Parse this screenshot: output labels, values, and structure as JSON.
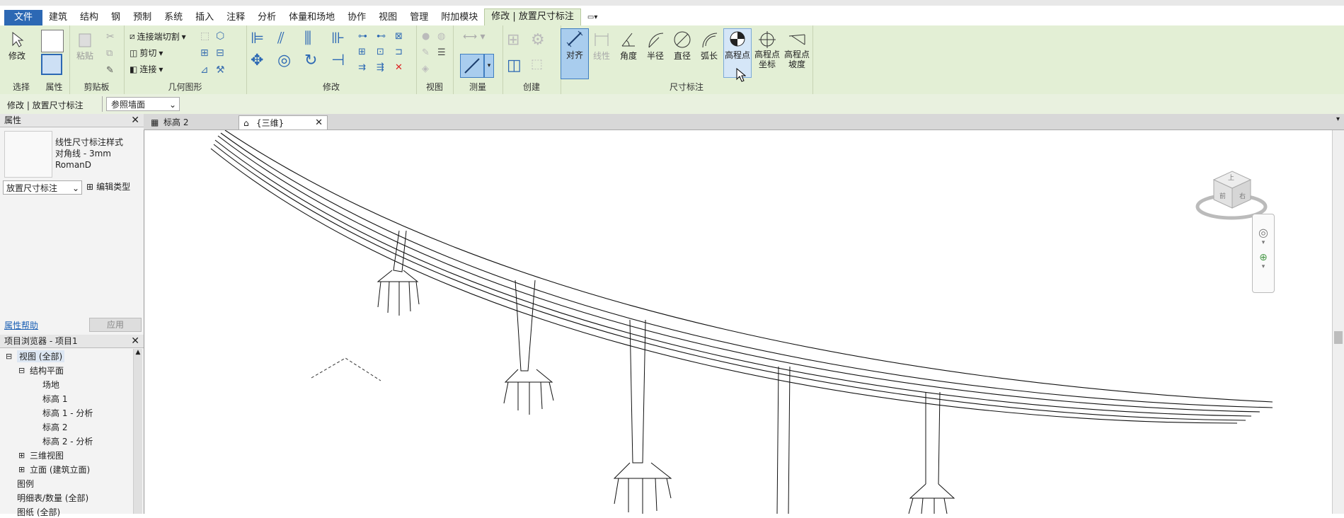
{
  "menu": {
    "tabs": [
      "文件",
      "建筑",
      "结构",
      "钢",
      "预制",
      "系统",
      "插入",
      "注释",
      "分析",
      "体量和场地",
      "协作",
      "视图",
      "管理",
      "附加模块",
      "修改 | 放置尺寸标注"
    ]
  },
  "ribbon": {
    "select": {
      "label": "修改",
      "panel": "选择"
    },
    "properties": {
      "panel": "属性"
    },
    "clipboard": {
      "paste": "粘贴",
      "panel": "剪贴板"
    },
    "geometry": {
      "cope": "连接端切割",
      "cut": "剪切",
      "join": "连接",
      "panel": "几何图形"
    },
    "modify": {
      "panel": "修改"
    },
    "view": {
      "panel": "视图"
    },
    "measure": {
      "panel": "测量"
    },
    "create": {
      "panel": "创建"
    },
    "dimension": {
      "panel": "尺寸标注",
      "buttons": [
        {
          "label": "对齐"
        },
        {
          "label": "线性"
        },
        {
          "label": "角度"
        },
        {
          "label": "半径"
        },
        {
          "label": "直径"
        },
        {
          "label": "弧长"
        },
        {
          "label": "高程点"
        },
        {
          "label": "高程点\n坐标"
        },
        {
          "label": "高程点\n坡度"
        }
      ]
    }
  },
  "options_bar": {
    "context": "修改 | 放置尺寸标注",
    "dropdown": "参照墙面"
  },
  "properties_panel": {
    "title": "属性",
    "type_lines": [
      "线性尺寸标注样式",
      "对角线 - 3mm",
      "RomanD"
    ],
    "selector": "放置尺寸标注",
    "edit_type": "编辑类型",
    "help": "属性帮助",
    "apply": "应用"
  },
  "project_browser": {
    "title": "项目浏览器 - 项目1",
    "items": [
      {
        "label": "视图 (全部)",
        "level": 0,
        "toggle": "⊟"
      },
      {
        "label": "结构平面",
        "level": 1,
        "toggle": "⊟"
      },
      {
        "label": "场地",
        "level": 2,
        "toggle": ""
      },
      {
        "label": "标高 1",
        "level": 2,
        "toggle": ""
      },
      {
        "label": "标高 1 - 分析",
        "level": 2,
        "toggle": ""
      },
      {
        "label": "标高 2",
        "level": 2,
        "toggle": ""
      },
      {
        "label": "标高 2 - 分析",
        "level": 2,
        "toggle": ""
      },
      {
        "label": "三维视图",
        "level": 1,
        "toggle": "⊞"
      },
      {
        "label": "立面 (建筑立面)",
        "level": 1,
        "toggle": "⊞"
      },
      {
        "label": "图例",
        "level": 0,
        "toggle": ""
      },
      {
        "label": "明细表/数量 (全部)",
        "level": 0,
        "toggle": ""
      },
      {
        "label": "图纸 (全部)",
        "level": 0,
        "toggle": ""
      }
    ]
  },
  "doc_tabs": [
    {
      "label": "标高 2"
    },
    {
      "label": "{三维}"
    }
  ],
  "viewcube": {
    "labels": [
      "上",
      "前",
      "右"
    ]
  }
}
